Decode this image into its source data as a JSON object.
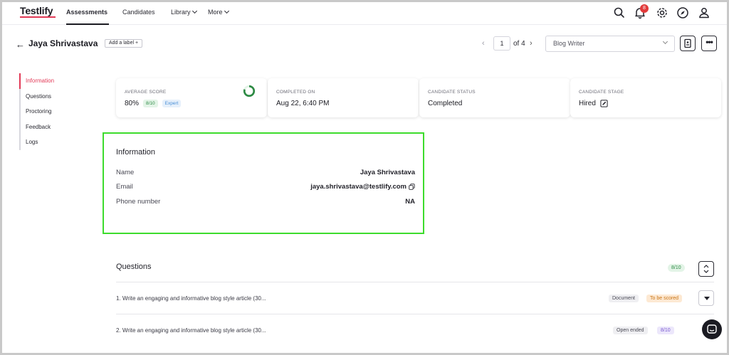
{
  "nav": {
    "logo": "Testlify",
    "items": [
      {
        "label": "Assessments"
      },
      {
        "label": "Candidates"
      },
      {
        "label": "Library"
      },
      {
        "label": "More"
      }
    ],
    "notification_count": "8"
  },
  "header": {
    "candidate_name": "Jaya Shrivastava",
    "add_label": "Add a label +",
    "page_current": "1",
    "page_total": "of 4",
    "role_selected": "Blog Writer"
  },
  "sidebar": {
    "items": [
      {
        "label": "Information"
      },
      {
        "label": "Questions"
      },
      {
        "label": "Proctoring"
      },
      {
        "label": "Feedback"
      },
      {
        "label": "Logs"
      }
    ]
  },
  "cards": {
    "average_score": {
      "label": "AVERAGE SCORE",
      "value": "80%",
      "fraction": "8/10",
      "level": "Expert",
      "progress": 0.8
    },
    "completed_on": {
      "label": "COMPLETED ON",
      "value": "Aug 22, 6:40 PM"
    },
    "candidate_status": {
      "label": "CANDIDATE STATUS",
      "value": "Completed"
    },
    "candidate_stage": {
      "label": "CANDIDATE STAGE",
      "value": "Hired"
    }
  },
  "information": {
    "title": "Information",
    "rows": [
      {
        "key": "Name",
        "value": "Jaya Shrivastava"
      },
      {
        "key": "Email",
        "value": "jaya.shrivastava@testlify.com"
      },
      {
        "key": "Phone number",
        "value": "NA"
      }
    ]
  },
  "questions": {
    "title": "Questions",
    "score": "8/10",
    "items": [
      {
        "text": "1.  Write an engaging and informative blog style article (30...",
        "type": "Document",
        "status": "To be scored"
      },
      {
        "text": "2.  Write an engaging and informative blog style article (30...",
        "type": "Open ended",
        "status": "8/10"
      }
    ]
  },
  "colors": {
    "accent": "#e23a57",
    "highlight": "#3ddc2c",
    "success": "#2d8a44"
  }
}
